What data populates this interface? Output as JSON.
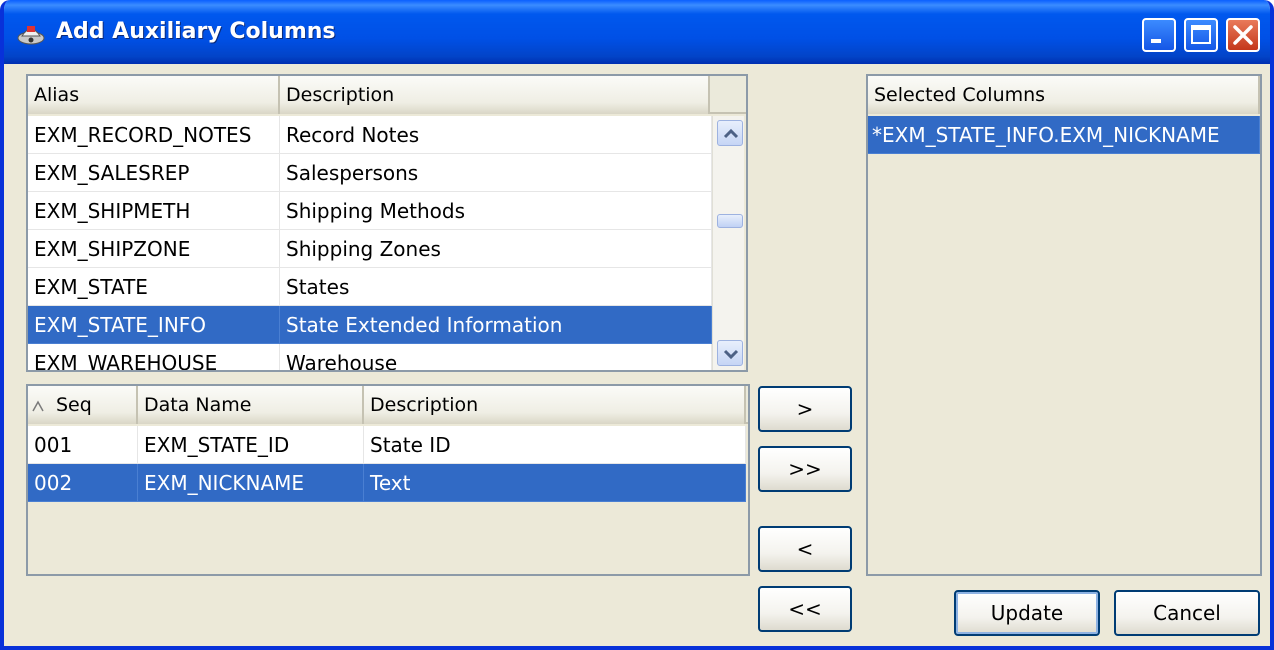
{
  "window": {
    "title": "Add Auxiliary Columns"
  },
  "tables_grid": {
    "headers": [
      "Alias",
      "Description"
    ],
    "rows": [
      {
        "alias": "EXM_RECORD_NOTES",
        "description": "Record Notes",
        "selected": false
      },
      {
        "alias": "EXM_SALESREP",
        "description": "Salespersons",
        "selected": false
      },
      {
        "alias": "EXM_SHIPMETH",
        "description": "Shipping Methods",
        "selected": false
      },
      {
        "alias": "EXM_SHIPZONE",
        "description": "Shipping Zones",
        "selected": false
      },
      {
        "alias": "EXM_STATE",
        "description": "States",
        "selected": false
      },
      {
        "alias": "EXM_STATE_INFO",
        "description": "State Extended Information",
        "selected": true
      },
      {
        "alias": "EXM_WAREHOUSE",
        "description": "Warehouse",
        "selected": false
      }
    ]
  },
  "columns_grid": {
    "headers": [
      "Seq",
      "Data Name",
      "Description"
    ],
    "sort_indicator": "sort-ascending-icon",
    "rows": [
      {
        "seq": "001",
        "data_name": "EXM_STATE_ID",
        "description": "State ID",
        "selected": false
      },
      {
        "seq": "002",
        "data_name": "EXM_NICKNAME",
        "description": "Text",
        "selected": true
      }
    ]
  },
  "selected_list": {
    "header": "Selected Columns",
    "items": [
      {
        "label": "*EXM_STATE_INFO.EXM_NICKNAME",
        "selected": true
      }
    ]
  },
  "buttons": {
    "add_one": ">",
    "add_all": ">>",
    "remove_one": "<",
    "remove_all": "<<",
    "update": "Update",
    "cancel": "Cancel"
  },
  "colors": {
    "titlebar": "#0054e3",
    "selection": "#316ac5",
    "dialog_bg": "#ece9d8"
  }
}
